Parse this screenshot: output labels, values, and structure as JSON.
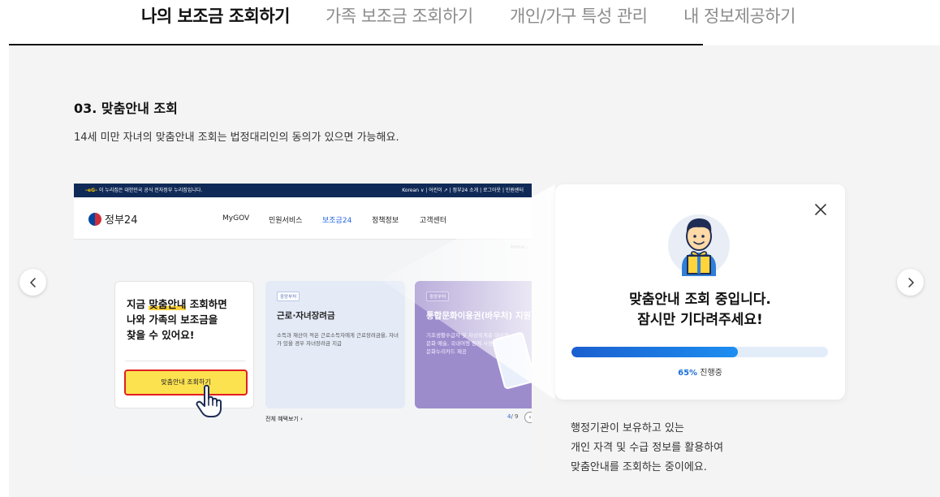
{
  "tabs": [
    {
      "label": "나의 보조금 조회하기",
      "active": true
    },
    {
      "label": "가족 보조금 조회하기",
      "active": false
    },
    {
      "label": "개인/가구 특성 관리",
      "active": false
    },
    {
      "label": "내 정보제공하기",
      "active": false
    }
  ],
  "step": {
    "title": "03. 맞춤안내 조회",
    "description": "14세 미만 자녀의 맞춤안내 조회는 법정대리인의 동의가 있으면 가능해요."
  },
  "mock_site": {
    "official_notice": "이 누리집은 대한민국 공식 전자정부 누리집입니다.",
    "utility_links": "Korean ∨ | 어린이 ↗ | 정부24 소개 | 로그아웃 | 민원센터",
    "logo_text": "정부24",
    "menu": [
      "MyGOV",
      "민원서비스",
      "보조금24",
      "정책정보",
      "고객센터"
    ],
    "active_menu": "보조금24",
    "breadcrumb": "Home ›",
    "card_main": {
      "line1_prefix": "지금 ",
      "line1_highlight": "맞춤안내",
      "line1_suffix": " 조회하면",
      "line2": "나와 가족의 보조금을",
      "line3": "찾을 수 있어요!",
      "button": "맞춤안내 조회하기"
    },
    "card_b": {
      "tag": "중앙부처",
      "title": "근로·자녀장려금",
      "body": "소득과 재산이 적은 근로소득자에게 근로장려금을, 자녀가 있을 경우 자녀장려금 지급"
    },
    "card_c": {
      "tag": "중앙부처",
      "title": "통합문화이용권(바우처) 지원",
      "body": "기초생활수급자 및 차상위계층 대상의 문화 예술, 국내여행 등에 사용 가능한 문화누리카드 제공"
    },
    "more_link": "전체 혜택보기  ›",
    "pager_current": "4",
    "pager_total": "/ 9"
  },
  "popup": {
    "line1": "맞춤안내 조회 중입니다.",
    "line2": "잠시만 기다려주세요!",
    "progress_percent": 65,
    "progress_value": "65%",
    "progress_label": " 진행중"
  },
  "note": {
    "line1": "행정기관이 보유하고 있는",
    "line2": "개인 자격 및 수급 정보를 활용하여",
    "line3": "맞춤안내를 조회하는 중이에요."
  },
  "colors": {
    "accent": "#1b6fd6",
    "highlight": "#fde24f",
    "callout_border": "#e02020",
    "panel_bg": "#f4f4f4"
  }
}
